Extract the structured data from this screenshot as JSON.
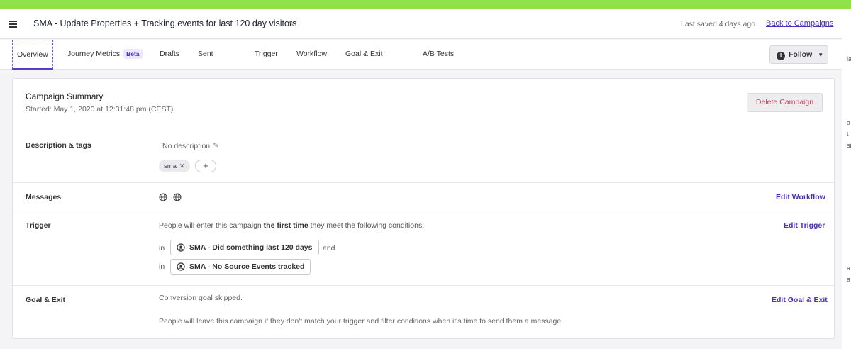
{
  "header": {
    "title": "SMA - Update Properties + Tracking events for last 120 day visitors",
    "last_saved": "Last saved 4 days ago",
    "back_link": "Back to Campaigns"
  },
  "tabs": [
    {
      "label": "Overview",
      "active": true
    },
    {
      "label": "Journey Metrics",
      "badge": "Beta"
    },
    {
      "label": "Drafts"
    },
    {
      "label": "Sent"
    },
    {
      "label": "Trigger"
    },
    {
      "label": "Workflow"
    },
    {
      "label": "Goal & Exit"
    },
    {
      "label": "A/B Tests"
    }
  ],
  "follow_label": "Follow",
  "summary": {
    "title": "Campaign Summary",
    "started": "Started: May 1, 2020 at 12:31:48 pm (CEST)",
    "delete_label": "Delete Campaign"
  },
  "description": {
    "label": "Description & tags",
    "text": "No description",
    "tag": "sma",
    "add_tag": "+"
  },
  "messages": {
    "label": "Messages",
    "edit": "Edit Workflow"
  },
  "trigger": {
    "label": "Trigger",
    "text_before": "People will enter this campaign ",
    "text_bold": "the first time",
    "text_after": " they meet the following conditions:",
    "in_word": "in",
    "and_word": "and",
    "conditions": [
      "SMA - Did something last 120 days",
      "SMA - No Source Events tracked"
    ],
    "edit": "Edit Trigger"
  },
  "goal": {
    "label": "Goal & Exit",
    "skipped": "Conversion goal skipped.",
    "exit_text": "People will leave this campaign if they don't match your trigger and filter conditions when it's time to send them a message.",
    "edit": "Edit Goal & Exit"
  },
  "edge_chars": [
    "la",
    "a",
    "t",
    "si",
    "a",
    "a"
  ],
  "colors": {
    "accent": "#4a2fbd",
    "topbar": "#8ee34a",
    "danger": "#d23c54"
  }
}
